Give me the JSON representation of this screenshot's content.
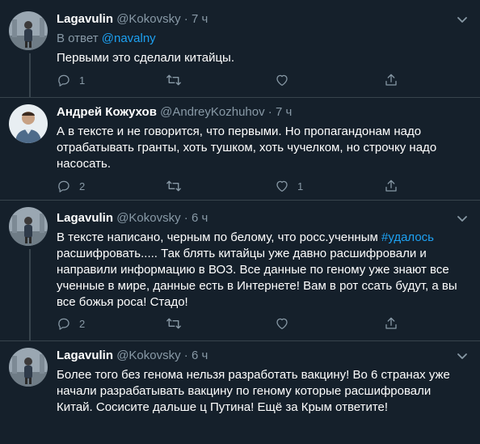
{
  "tweets": [
    {
      "name": "Lagavulin",
      "handle": "@Kokovsky",
      "time": "· 7 ч",
      "reply_prefix": "В ответ ",
      "reply_handle": "@navalny",
      "text": "Первыми это сделали китайцы.",
      "replies": "1",
      "retweets": "",
      "likes": ""
    },
    {
      "name": "Андрей Кожухов",
      "handle": "@AndreyKozhuhov",
      "time": "· 7 ч",
      "text": "А в тексте и не говорится, что первыми. Но пропагандонам надо отрабатывать гранты, хоть тушком, хоть чучелком, но строчку надо насосать.",
      "replies": "2",
      "retweets": "",
      "likes": "1"
    },
    {
      "name": "Lagavulin",
      "handle": "@Kokovsky",
      "time": "· 6 ч",
      "text_before": "В тексте написано, черным по белому, что росс.ученным ",
      "hashtag": "#удалось",
      "text_after": " расшифровать..... Так блять китайцы уже давно расшифровали и направили информацию в ВОЗ. Все данные по геному уже знают все ученные в мире, данные есть в Интернете! Вам в рот ссать будут, а вы все божья роса! Стадо!",
      "replies": "2",
      "retweets": "",
      "likes": ""
    },
    {
      "name": "Lagavulin",
      "handle": "@Kokovsky",
      "time": "· 6 ч",
      "text": "Более того без генома нельзя разработать вакцину! Во 6 странах уже начали разрабатывать вакцину  по геному которые расшифровали Китай. Сосисите дальше ц Путина! Ещё за Крым ответите!"
    }
  ],
  "colors": {
    "background": "#15202b",
    "text": "#ffffff",
    "muted": "#8899a6",
    "link": "#1da1f2",
    "divider": "#38444d"
  },
  "icons": [
    "reply-icon",
    "retweet-icon",
    "like-icon",
    "share-icon",
    "more-caret-icon"
  ]
}
